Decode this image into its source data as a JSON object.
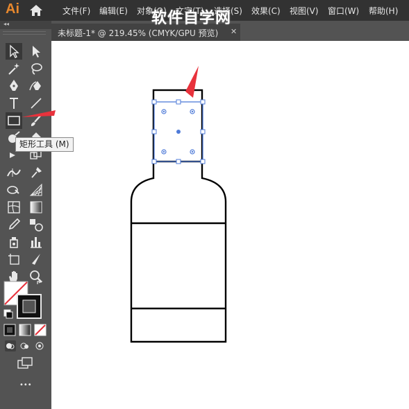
{
  "app": {
    "logo": "Ai"
  },
  "menu": {
    "items": [
      "文件(F)",
      "编辑(E)",
      "对象(O)",
      "文字(T)",
      "选择(S)",
      "效果(C)",
      "视图(V)",
      "窗口(W)",
      "帮助(H)"
    ]
  },
  "document": {
    "tab_title": "未标题-1* @ 219.45% (CMYK/GPU 预览)",
    "close_symbol": "✕",
    "watermark": "软件自学网"
  },
  "toolbar": {
    "collapse_symbol": "◂◂",
    "more_symbol": "•••",
    "tools": [
      {
        "name": "selection-tool-icon"
      },
      {
        "name": "direct-selection-tool-icon"
      },
      {
        "name": "magic-wand-tool-icon"
      },
      {
        "name": "lasso-tool-icon"
      },
      {
        "name": "pen-tool-icon"
      },
      {
        "name": "curvature-tool-icon"
      },
      {
        "name": "type-tool-icon"
      },
      {
        "name": "line-segment-tool-icon"
      },
      {
        "name": "rectangle-tool-icon",
        "active": true
      },
      {
        "name": "paintbrush-tool-icon"
      },
      {
        "name": "shaper-tool-icon"
      },
      {
        "name": "eraser-tool-icon"
      },
      {
        "name": "rotate-tool-icon"
      },
      {
        "name": "scale-tool-icon"
      },
      {
        "name": "width-tool-icon"
      },
      {
        "name": "puppet-warp-tool-icon"
      },
      {
        "name": "shape-builder-tool-icon"
      },
      {
        "name": "perspective-grid-tool-icon"
      },
      {
        "name": "mesh-tool-icon"
      },
      {
        "name": "gradient-tool-icon"
      },
      {
        "name": "eyedropper-tool-icon"
      },
      {
        "name": "blend-tool-icon"
      },
      {
        "name": "symbol-sprayer-tool-icon"
      },
      {
        "name": "column-graph-tool-icon"
      },
      {
        "name": "artboard-tool-icon"
      },
      {
        "name": "slice-tool-icon"
      },
      {
        "name": "hand-tool-icon"
      },
      {
        "name": "zoom-tool-icon"
      }
    ],
    "tooltip": "矩形工具 (M)",
    "fill_color": "#ffffff",
    "stroke_color": "#000000",
    "colors": {
      "toolbar_bg": "#535353",
      "menubar_bg": "#323232",
      "selection": "#4f7bd8",
      "arrow": "#e8323c"
    }
  }
}
